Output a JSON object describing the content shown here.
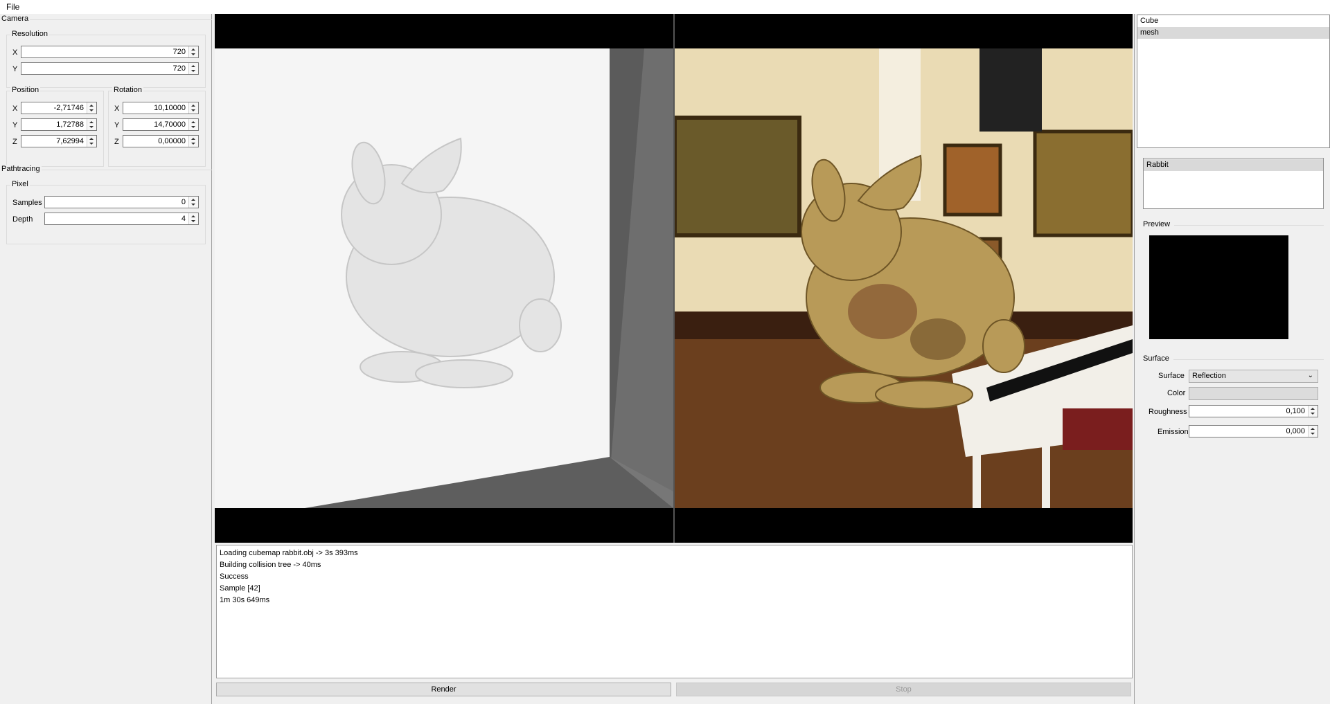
{
  "menu": {
    "file": "File"
  },
  "camera": {
    "title": "Camera",
    "resolution": {
      "title": "Resolution",
      "x_label": "X",
      "x": "720",
      "y_label": "Y",
      "y": "720"
    },
    "position": {
      "title": "Position",
      "x_label": "X",
      "x": "-2,71746",
      "y_label": "Y",
      "y": "1,72788",
      "z_label": "Z",
      "z": "7,62994"
    },
    "rotation": {
      "title": "Rotation",
      "x_label": "X",
      "x": "10,10000",
      "y_label": "Y",
      "y": "14,70000",
      "z_label": "Z",
      "z": "0,00000"
    }
  },
  "pathtracing": {
    "title": "Pathtracing",
    "pixel": {
      "title": "Pixel",
      "samples_label": "Samples",
      "samples": "0",
      "depth_label": "Depth",
      "depth": "4"
    }
  },
  "log": {
    "lines": [
      "Loading cubemap rabbit.obj -> 3s 393ms",
      "Building collision tree -> 40ms",
      "Success",
      "Sample [42]",
      "1m 30s 649ms"
    ]
  },
  "buttons": {
    "render": "Render",
    "stop": "Stop"
  },
  "scene_list": {
    "items": [
      "Cube",
      "mesh"
    ],
    "selected_index": 1
  },
  "object_list": {
    "items": [
      "Rabbit"
    ],
    "selected_index": 0
  },
  "preview": {
    "title": "Preview"
  },
  "surface": {
    "title": "Surface",
    "type_label": "Surface",
    "type": "Reflection",
    "color_label": "Color",
    "color": "#dcdcdc",
    "roughness_label": "Roughness",
    "roughness": "0,100",
    "emission_label": "Emission",
    "emission": "0,000"
  },
  "colors": {
    "viewport_bg": "#000000",
    "bunny": "#e6e6e6",
    "bunny_gold": "#b89a58"
  }
}
